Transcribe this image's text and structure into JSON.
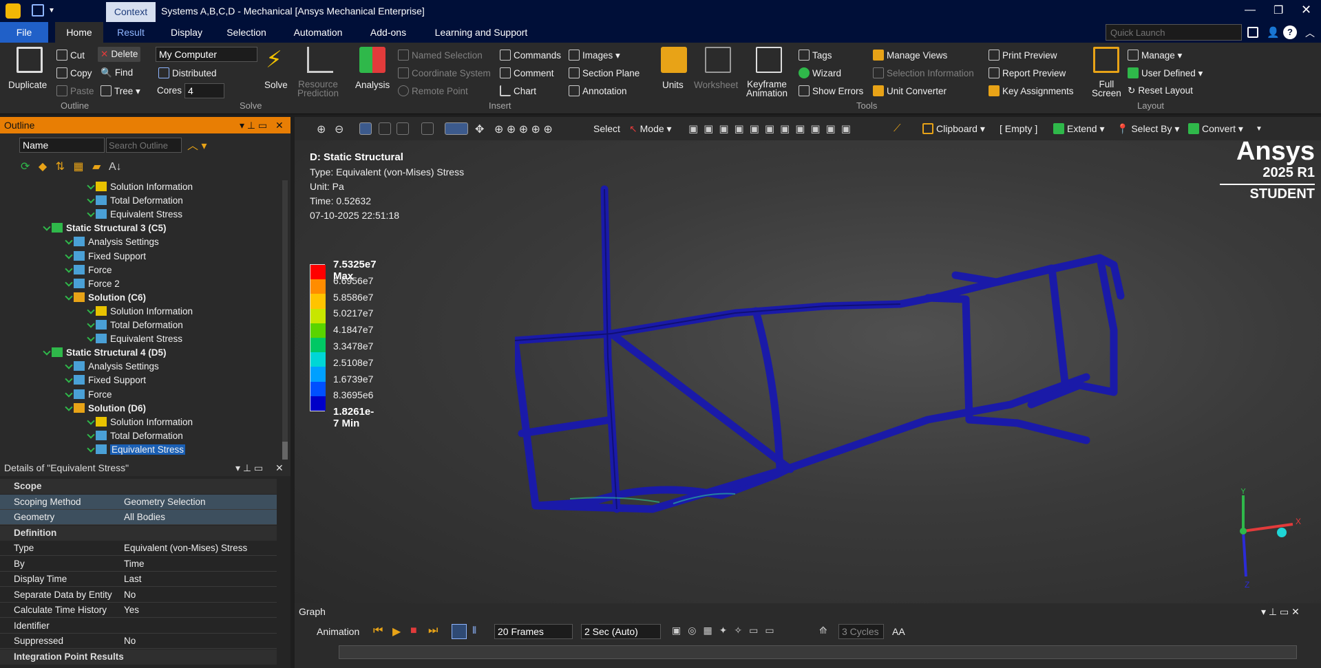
{
  "title": {
    "context_tab": "Context",
    "text": "Systems A,B,C,D - Mechanical [Ansys Mechanical Enterprise]"
  },
  "menu": {
    "file": "File",
    "tabs": [
      "Home",
      "Result",
      "Display",
      "Selection",
      "Automation",
      "Add-ons",
      "Learning and Support"
    ],
    "active": "Home",
    "quick_launch_placeholder": "Quick Launch"
  },
  "ribbon": {
    "outline_group": {
      "label": "Outline",
      "duplicate": "Duplicate",
      "cut": "Cut",
      "copy": "Copy",
      "paste": "Paste",
      "delete": "Delete",
      "find": "Find",
      "tree": "Tree"
    },
    "solve_group": {
      "label": "Solve",
      "computer": "My Computer",
      "distributed": "Distributed",
      "cores_label": "Cores",
      "cores_value": "4",
      "solve": "Solve",
      "resource": "Resource",
      "prediction": "Prediction"
    },
    "insert_group": {
      "label": "Insert",
      "analysis": "Analysis",
      "named_selection": "Named Selection",
      "coordinate_system": "Coordinate System",
      "remote_point": "Remote Point",
      "commands": "Commands",
      "comment": "Comment",
      "chart": "Chart",
      "images": "Images",
      "section_plane": "Section Plane",
      "annotation": "Annotation"
    },
    "tools_group": {
      "label": "Tools",
      "units": "Units",
      "worksheet": "Worksheet",
      "keyframe": "Keyframe",
      "animation": "Animation",
      "tags": "Tags",
      "wizard": "Wizard",
      "show_errors": "Show Errors",
      "manage_views": "Manage Views",
      "selection_information": "Selection Information",
      "unit_converter": "Unit Converter",
      "print_preview": "Print Preview",
      "report_preview": "Report Preview",
      "key_assignments": "Key Assignments"
    },
    "layout_group": {
      "label": "Layout",
      "full": "Full",
      "screen": "Screen",
      "manage": "Manage",
      "user_defined": "User Defined",
      "reset_layout": "Reset Layout"
    }
  },
  "outline": {
    "title": "Outline",
    "name_filter": "Name",
    "search_placeholder": "Search Outline",
    "items": [
      {
        "label": "Solution Information",
        "level": 3
      },
      {
        "label": "Total Deformation",
        "level": 3
      },
      {
        "label": "Equivalent Stress",
        "level": 3
      },
      {
        "label": "Static Structural 3 (C5)",
        "level": 1
      },
      {
        "label": "Analysis Settings",
        "level": 2
      },
      {
        "label": "Fixed Support",
        "level": 2
      },
      {
        "label": "Force",
        "level": 2
      },
      {
        "label": "Force 2",
        "level": 2
      },
      {
        "label": "Solution (C6)",
        "level": 2
      },
      {
        "label": "Solution Information",
        "level": 3
      },
      {
        "label": "Total Deformation",
        "level": 3
      },
      {
        "label": "Equivalent Stress",
        "level": 3
      },
      {
        "label": "Static Structural 4 (D5)",
        "level": 1
      },
      {
        "label": "Analysis Settings",
        "level": 2
      },
      {
        "label": "Fixed Support",
        "level": 2
      },
      {
        "label": "Force",
        "level": 2
      },
      {
        "label": "Solution (D6)",
        "level": 2
      },
      {
        "label": "Solution Information",
        "level": 3
      },
      {
        "label": "Total Deformation",
        "level": 3
      },
      {
        "label": "Equivalent Stress",
        "level": 3
      }
    ]
  },
  "details": {
    "title": "Details of \"Equivalent Stress\"",
    "rows": [
      {
        "section": "Scope"
      },
      {
        "k": "Scoping Method",
        "v": "Geometry Selection"
      },
      {
        "k": "Geometry",
        "v": "All Bodies"
      },
      {
        "section": "Definition"
      },
      {
        "k": "Type",
        "v": "Equivalent (von-Mises) Stress"
      },
      {
        "k": "By",
        "v": "Time"
      },
      {
        "k": "Display Time",
        "v": "Last"
      },
      {
        "k": "Separate Data by Entity",
        "v": "No"
      },
      {
        "k": "Calculate Time History",
        "v": "Yes"
      },
      {
        "k": "Identifier",
        "v": ""
      },
      {
        "k": "Suppressed",
        "v": "No"
      },
      {
        "section": "Integration Point Results"
      }
    ]
  },
  "viewport_toolbar": {
    "select": "Select",
    "mode": "Mode",
    "clipboard": "Clipboard",
    "empty": "[ Empty ]",
    "extend": "Extend",
    "select_by": "Select By",
    "convert": "Convert"
  },
  "result": {
    "title": "D: Static Structural",
    "type": "Type: Equivalent (von-Mises) Stress",
    "unit": "Unit: Pa",
    "time": "Time: 0.52632",
    "date": "07-10-2025 22:51:18",
    "legend": [
      "7.5325e7 Max",
      "6.6956e7",
      "5.8586e7",
      "5.0217e7",
      "4.1847e7",
      "3.3478e7",
      "2.5108e7",
      "1.6739e7",
      "8.3695e6",
      "1.8261e-7 Min"
    ],
    "legend_colors": [
      "#ff0000",
      "#ff8c00",
      "#ffc400",
      "#c8e600",
      "#5ad400",
      "#00c864",
      "#00d6d6",
      "#00a0ff",
      "#0050ff",
      "#0000c8"
    ]
  },
  "logo": {
    "brand": "Ansys",
    "version": "2025 R1",
    "edition": "STUDENT"
  },
  "graph": {
    "title": "Graph",
    "animation": "Animation",
    "frames": "20 Frames",
    "duration": "2 Sec (Auto)",
    "cycles": "3 Cycles",
    "aa": "AA"
  },
  "triad": {
    "x": "X",
    "y": "Y",
    "z": "Z"
  }
}
